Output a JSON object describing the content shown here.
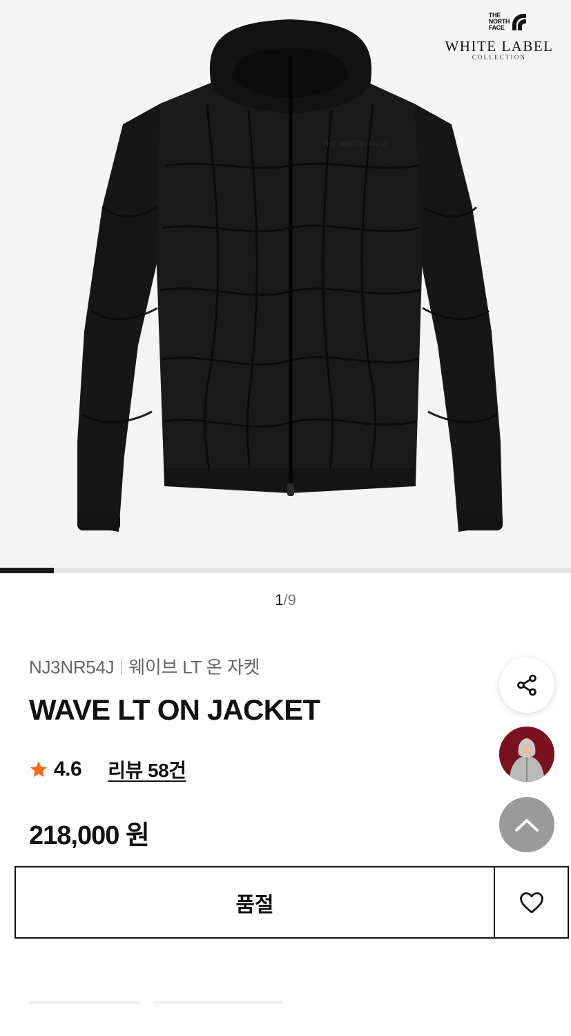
{
  "brand": {
    "tnf_lines": [
      "THE",
      "NORTH",
      "FACE"
    ],
    "label": "WHITE LABEL",
    "sub": "COLLECTION"
  },
  "gallery": {
    "current": "1",
    "separator": "/",
    "total": "9",
    "progress_fraction": 0.111
  },
  "product": {
    "code": "NJ3NR54J",
    "name_ko": "웨이브 LT 온 자켓",
    "name_en": "WAVE LT ON JACKET",
    "rating": "4.6",
    "reviews_label": "리뷰 58건",
    "price": "218,000 원"
  },
  "actions": {
    "buy_label": "품절"
  },
  "icons": {
    "share": "share-icon",
    "avatar": "avatar",
    "scroll_top": "chevron-up-icon",
    "wishlist": "heart-icon",
    "rating": "star-icon"
  },
  "colors": {
    "star": "#f26b1d",
    "progress": "#1a1a1a",
    "scroll_top_bg": "#9a9a9a",
    "avatar_bg": "#7a1020"
  }
}
